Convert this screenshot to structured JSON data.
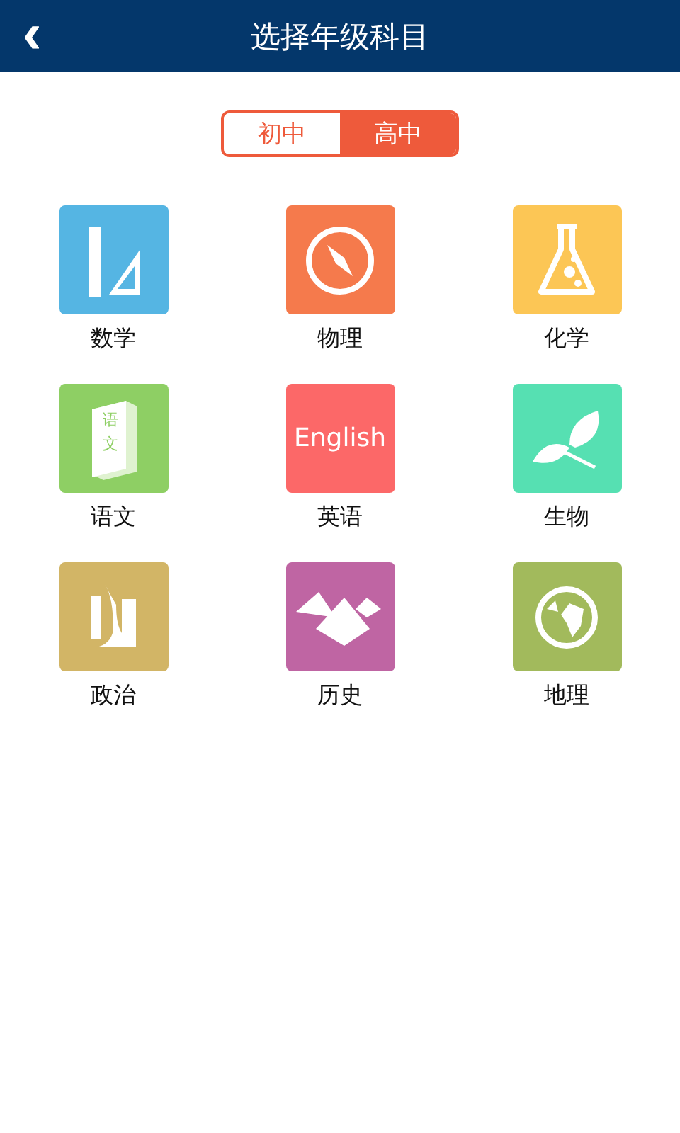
{
  "header": {
    "back_icon": "‹",
    "title": "选择年级科目"
  },
  "levels": [
    {
      "label": "初中",
      "selected": false
    },
    {
      "label": "高中",
      "selected": true
    }
  ],
  "subjects": [
    {
      "kind": "ruler",
      "label": "数学",
      "color": "#55b5e3"
    },
    {
      "kind": "compass",
      "label": "物理",
      "color": "#f57a4c"
    },
    {
      "kind": "flask",
      "label": "化学",
      "color": "#fcc655"
    },
    {
      "kind": "book",
      "label": "语文",
      "color": "#8ecf64",
      "icon_text": "语文"
    },
    {
      "kind": "text",
      "label": "英语",
      "color": "#fc6868",
      "icon_text": "English"
    },
    {
      "kind": "leaf",
      "label": "生物",
      "color": "#56e0b2"
    },
    {
      "kind": "pillar",
      "label": "政治",
      "color": "#d2b566"
    },
    {
      "kind": "pyramid",
      "label": "历史",
      "color": "#bf65a3"
    },
    {
      "kind": "globe",
      "label": "地理",
      "color": "#a2ba5c"
    }
  ]
}
